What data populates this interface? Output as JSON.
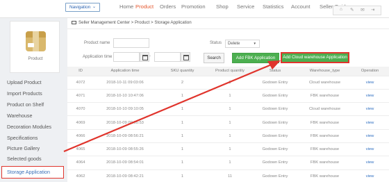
{
  "nav": {
    "dropdown_label": "Navigation",
    "items": [
      "Home",
      "Product",
      "Orders",
      "Promotion",
      "Shop",
      "Service",
      "Statistics",
      "Account",
      "Seller Guider"
    ],
    "active": "Product",
    "tool_icons": [
      "home-icon",
      "tool-icon",
      "mail-icon",
      "exit-icon"
    ]
  },
  "sidebar": {
    "product_label": "Product",
    "items": [
      "Upload Product",
      "Import Products",
      "Product on Shelf",
      "Warehouse",
      "Decoration Modules",
      "Specifications",
      "Picture Gallery",
      "Selected goods",
      "Storage Application"
    ],
    "active": "Storage Application"
  },
  "breadcrumb": "Seller Management Center > Product > Storage Application",
  "filters": {
    "product_name_label": "Product name",
    "status_label": "Status",
    "status_value": "Delete",
    "application_time_label": "Application time",
    "range_dash": "-"
  },
  "buttons": {
    "search": "Search",
    "fbk": "Add FBK Application",
    "cloud": "Add Cloud warehouse Application"
  },
  "table": {
    "headers": [
      "ID",
      "Application time",
      "SKU quantity",
      "Product quantity",
      "Status",
      "Warehouse_type",
      "Operation"
    ],
    "rows": [
      [
        "4072",
        "2018-10-11 09:03:06",
        "2",
        "1",
        "Godown Entry",
        "Cloud warehouse",
        "view"
      ],
      [
        "4071",
        "2018-10-10 10:47:06",
        "1",
        "1",
        "Godown Entry",
        "FBK warehouse",
        "view"
      ],
      [
        "4070",
        "2018-10-10 09:10:05",
        "1",
        "1",
        "Godown Entry",
        "Cloud warehouse",
        "view"
      ],
      [
        "4069",
        "2018-10-09 09:05:53",
        "1",
        "1",
        "Godown Entry",
        "FBK warehouse",
        "view"
      ],
      [
        "4066",
        "2018-10-09 08:56:21",
        "1",
        "1",
        "Godown Entry",
        "FBK warehouse",
        "view"
      ],
      [
        "4065",
        "2018-10-09 08:55:26",
        "1",
        "1",
        "Godown Entry",
        "FBK warehouse",
        "view"
      ],
      [
        "4064",
        "2018-10-09 08:54:01",
        "1",
        "1",
        "Godown Entry",
        "FBK warehouse",
        "view"
      ],
      [
        "4062",
        "2018-10-09 08:42:21",
        "1",
        "11",
        "Godown Entry",
        "FBK warehouse",
        "view"
      ]
    ]
  },
  "colors": {
    "accent": "#e4572e",
    "link": "#2f6fc1",
    "button_green": "#4caf50",
    "highlight_red": "#e0342c"
  }
}
